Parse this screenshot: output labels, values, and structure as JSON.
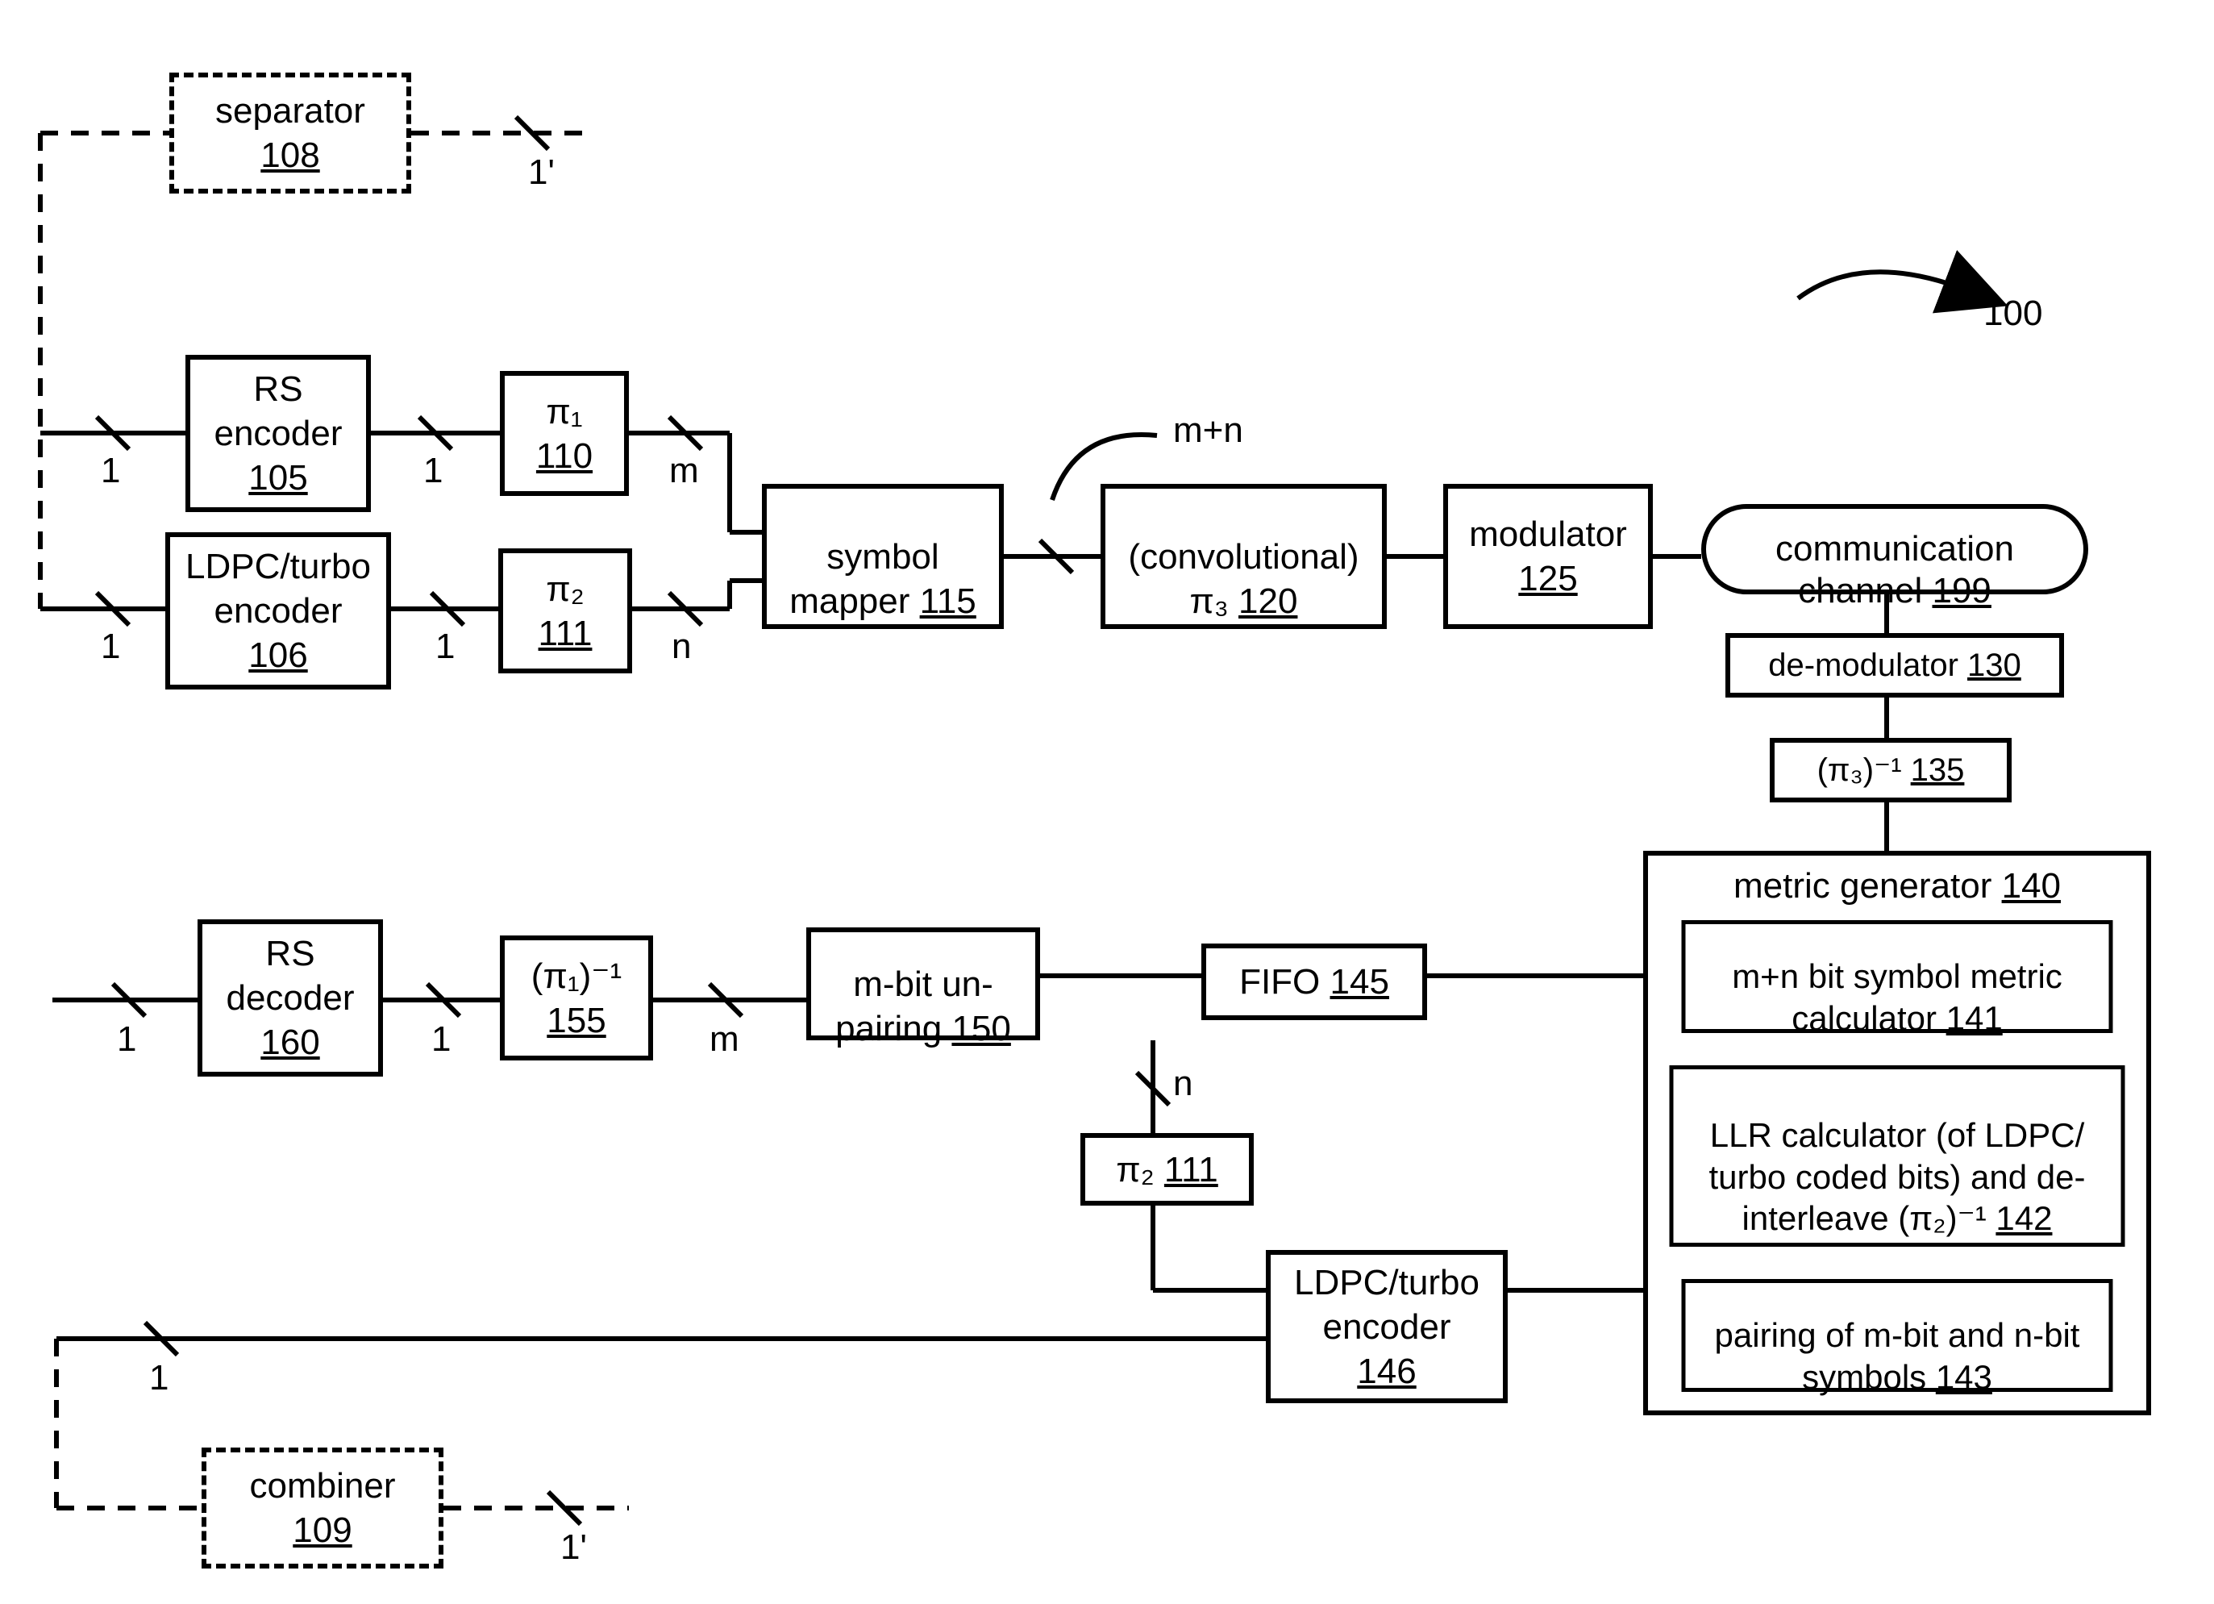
{
  "diagram_number": "100",
  "separator": {
    "label": "separator",
    "ref": "108"
  },
  "rs_encoder": {
    "label": "RS\nencoder",
    "ref": "105"
  },
  "pi1": {
    "label": "π₁",
    "ref": "110"
  },
  "ldpc_turbo_encoder_tx": {
    "label": "LDPC/turbo\nencoder",
    "ref": "106"
  },
  "pi2_tx": {
    "label": "π₂",
    "ref": "111"
  },
  "symbol_mapper": {
    "label": "symbol\nmapper ",
    "ref": "115"
  },
  "conv_pi3": {
    "label": "(convolutional)\nπ₃ ",
    "ref": "120"
  },
  "modulator": {
    "label": "modulator",
    "ref": "125"
  },
  "channel": {
    "label": "communication\nchannel ",
    "ref": "199"
  },
  "demod": {
    "label": "de-modulator ",
    "ref": "130"
  },
  "inv_pi3": {
    "label": "(π₃)⁻¹ ",
    "ref": "135"
  },
  "metric_generator": {
    "title": "metric generator ",
    "ref": "140",
    "symbol_metric": {
      "label": "m+n bit symbol metric\ncalculator ",
      "ref": "141"
    },
    "llr": {
      "label": "LLR calculator (of LDPC/\nturbo coded bits) and de-\ninterleave (π₂)⁻¹ ",
      "ref": "142"
    },
    "pairing": {
      "label": "pairing of m-bit and n-bit\nsymbols ",
      "ref": "143"
    }
  },
  "fifo": {
    "label": "FIFO ",
    "ref": "145"
  },
  "mbit_unpair": {
    "label": "m-bit un-\npairing ",
    "ref": "150"
  },
  "inv_pi1": {
    "label": "(π₁)⁻¹",
    "ref": "155"
  },
  "rs_decoder": {
    "label": "RS\ndecoder",
    "ref": "160"
  },
  "pi2_rx": {
    "label": "π₂ ",
    "ref": "111"
  },
  "ldpc_turbo_encoder_rx": {
    "label": "LDPC/turbo\nencoder",
    "ref": "146"
  },
  "combiner": {
    "label": "combiner",
    "ref": "109"
  },
  "slash": {
    "one": "1",
    "one_prime": "1'",
    "m": "m",
    "n": "n",
    "mn": "m+n"
  }
}
